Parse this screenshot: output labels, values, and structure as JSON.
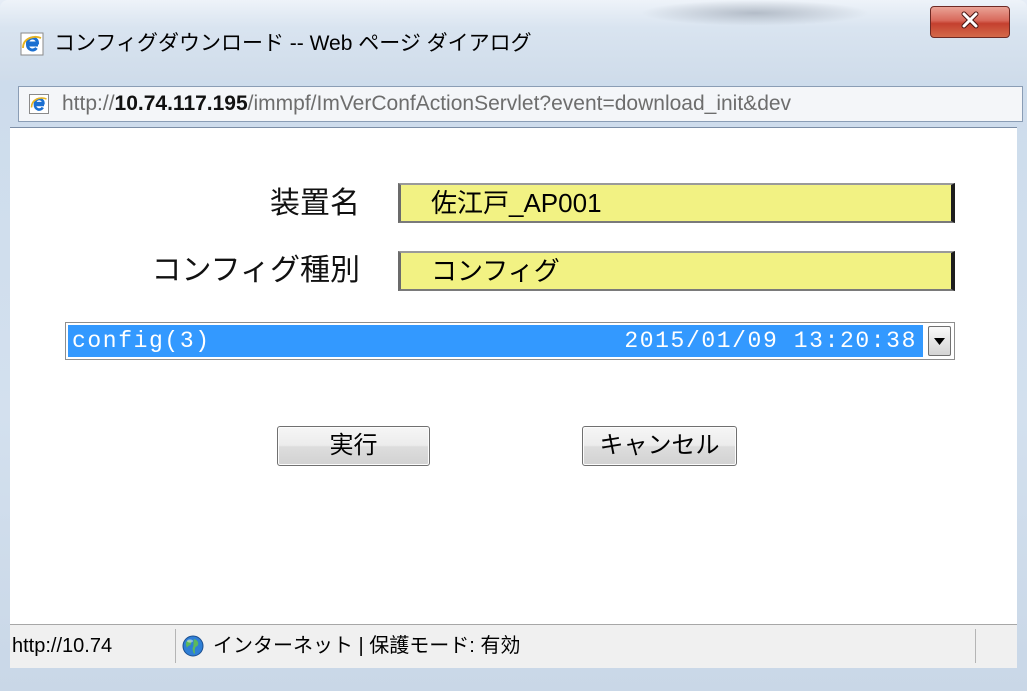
{
  "window": {
    "title": "コンフィグダウンロード -- Web ページ ダイアログ"
  },
  "address_bar": {
    "scheme": "http://",
    "host": "10.74.117.195",
    "path": "/immpf/ImVerConfActionServlet?event=download_init&dev"
  },
  "form": {
    "device_name": {
      "label": "装置名",
      "value": "佐江戸_AP001"
    },
    "config_type": {
      "label": "コンフィグ種別",
      "value": "コンフィグ"
    },
    "config_version": {
      "selected_name": "config(3)",
      "selected_datetime": "2015/01/09 13:20:38"
    }
  },
  "buttons": {
    "execute": "実行",
    "cancel": "キャンセル"
  },
  "status_bar": {
    "url": "http://10.74",
    "zone": "インターネット | 保護モード: 有効"
  },
  "icons": {
    "title": "ie-page-icon",
    "close": "close-icon",
    "address": "ie-page-icon",
    "select_arrow": "chevron-down-icon",
    "zone": "globe-icon"
  },
  "colors": {
    "field_background": "#f2f283",
    "selection": "#3399ff",
    "close_button": "#c4402f"
  }
}
